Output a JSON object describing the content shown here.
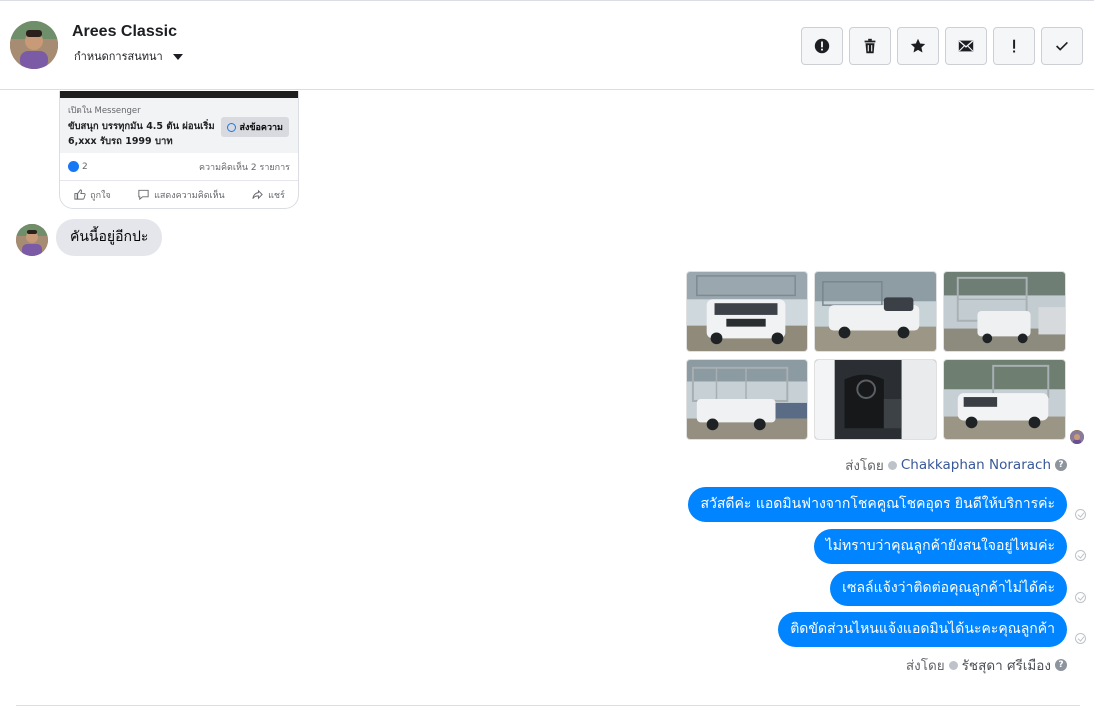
{
  "header": {
    "contact_name": "Arees Classic",
    "assign_label": "กำหนดการสนทนา",
    "toolbar": [
      {
        "name": "spam-button",
        "icon": "alert-circle-icon"
      },
      {
        "name": "delete-button",
        "icon": "trash-icon"
      },
      {
        "name": "star-button",
        "icon": "star-icon"
      },
      {
        "name": "mark-unread-button",
        "icon": "envelope-icon"
      },
      {
        "name": "important-button",
        "icon": "exclamation-icon"
      },
      {
        "name": "done-button",
        "icon": "check-icon"
      }
    ]
  },
  "shared_post": {
    "source": "เปิดใน Messenger",
    "title": "ขับสนุก บรรทุกมัน 4.5 ตัน ผ่อนเริ่ม 6,xxx รับรถ 1999 บาท",
    "send_button": "ส่งข้อความ",
    "likes": "2",
    "comments": "ความคิดเห็น 2 รายการ",
    "actions": {
      "like": "ถูกใจ",
      "comment": "แสดงความคิดเห็น",
      "share": "แชร์"
    }
  },
  "incoming": {
    "text": "คันนี้อยู่อีกปะ"
  },
  "photo_block": {
    "photos": [
      {
        "name": "photo-truck-front",
        "icon": "truck-photo"
      },
      {
        "name": "photo-truck-side",
        "icon": "truck-photo"
      },
      {
        "name": "photo-truck-rack",
        "icon": "truck-photo"
      },
      {
        "name": "photo-truck-rear",
        "icon": "truck-photo"
      },
      {
        "name": "photo-truck-interior",
        "icon": "interior-photo"
      },
      {
        "name": "photo-truck-angle",
        "icon": "truck-photo"
      }
    ],
    "sent_by_prefix": "ส่งโดย",
    "sent_by_agent": "Chakkaphan Norarach"
  },
  "outgoing": {
    "messages": [
      "สวัสดีค่ะ แอดมินฟางจากโชคคูณโชคอุดร ยินดีให้บริการค่ะ",
      "ไม่ทราบว่าคุณลูกค้ายังสนใจอยู่ไหมค่ะ",
      "เซลล์แจ้งว่าติดต่อคุณลูกค้าไม่ได้ค่ะ",
      "ติดขัดส่วนไหนแจ้งแอดมินได้นะคะคุณลูกค้า"
    ],
    "sent_by_prefix": "ส่งโดย",
    "sent_by_agent": "รัชสุดา ศรีเมือง"
  },
  "colors": {
    "outgoing_bubble": "#0084ff",
    "incoming_bubble": "#e4e6eb",
    "agent_link": "#385898"
  }
}
